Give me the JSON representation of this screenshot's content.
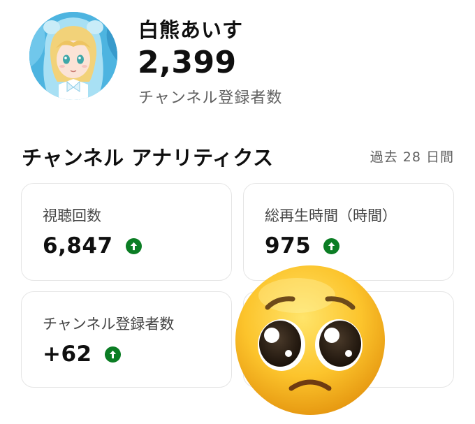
{
  "channel": {
    "name": "白熊あいす",
    "subscriber_count": "2,399",
    "subscriber_label": "チャンネル登録者数"
  },
  "analytics": {
    "title": "チャンネル アナリティクス",
    "period": "過去 28 日間",
    "cards": [
      {
        "label": "視聴回数",
        "value": "6,847",
        "trend": "up"
      },
      {
        "label": "総再生時間（時間）",
        "value": "975",
        "trend": "up"
      },
      {
        "label": "チャンネル登録者数",
        "value": "+62",
        "trend": "up"
      }
    ]
  },
  "colors": {
    "trend_up": "#0b7d24",
    "secondary_text": "#606060",
    "card_border": "#e5e5e5"
  },
  "icons": [
    "avatar-illustration",
    "arrow-up-icon",
    "pleading-face-emoji"
  ]
}
